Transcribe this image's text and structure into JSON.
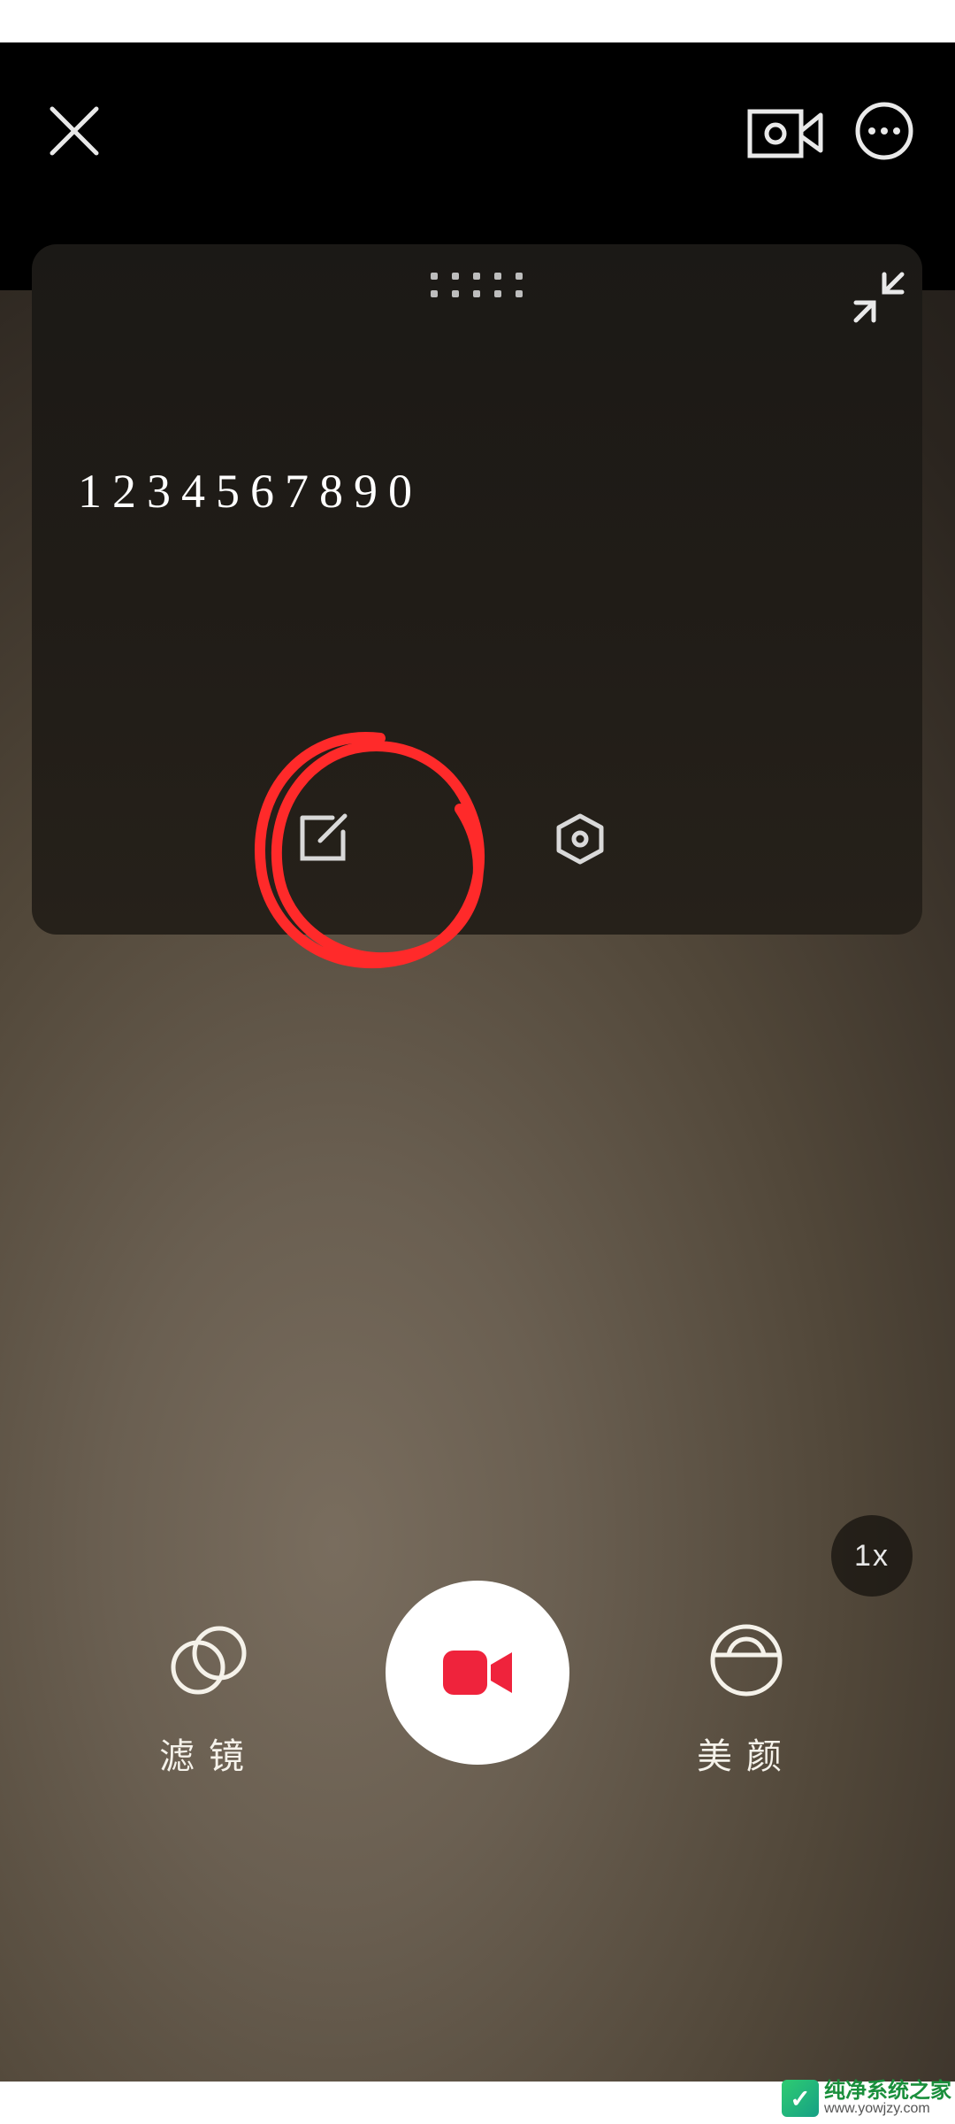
{
  "teleprompter": {
    "text": "1234567890"
  },
  "controls": {
    "filter_label": "滤镜",
    "beauty_label": "美颜",
    "zoom_label": "1x"
  },
  "icons": {
    "close": "close-icon",
    "teleprompter": "teleprompter-icon",
    "more": "more-horizontal-icon",
    "drag": "drag-handle-icon",
    "collapse": "collapse-icon",
    "edit": "edit-icon",
    "settings": "settings-hex-icon",
    "record": "video-record-icon",
    "filter": "filter-icon",
    "beauty": "beauty-face-icon"
  },
  "colors": {
    "record_accent": "#ef233c",
    "annotation": "#ff2a2a"
  },
  "watermark": {
    "line1": "纯净系统之家",
    "line2": "www.yowjzy.com"
  }
}
